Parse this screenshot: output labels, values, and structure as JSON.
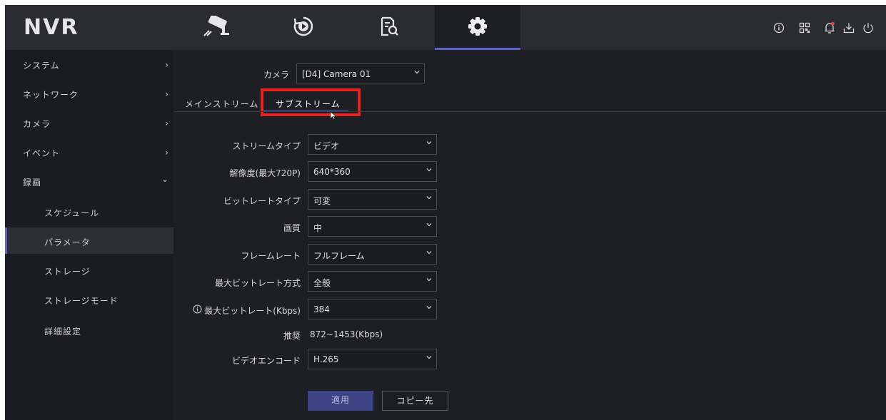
{
  "app": {
    "logo": "NVR"
  },
  "main_tabs": [
    {
      "icon": "camera-icon"
    },
    {
      "icon": "playback-icon"
    },
    {
      "icon": "search-file-icon"
    },
    {
      "icon": "gear-icon",
      "active": true
    }
  ],
  "top_icons": [
    "info-icon",
    "qr-code-icon",
    "bell-icon",
    "download-icon",
    "power-icon"
  ],
  "sidebar": {
    "items": [
      {
        "label": "システム",
        "arrow": "›"
      },
      {
        "label": "ネットワーク",
        "arrow": "›"
      },
      {
        "label": "カメラ",
        "arrow": "›"
      },
      {
        "label": "イベント",
        "arrow": "›"
      },
      {
        "label": "録画",
        "arrow": "⌄"
      },
      {
        "label": "スケジュール"
      },
      {
        "label": "パラメータ",
        "active": true
      },
      {
        "label": "ストレージ"
      },
      {
        "label": "ストレージモード"
      },
      {
        "label": "詳細設定"
      }
    ]
  },
  "camera": {
    "label": "カメラ",
    "value": "[D4] Camera 01"
  },
  "stream_tabs": {
    "main": "メインストリーム",
    "sub": "サブストリーム"
  },
  "form": {
    "stream_type": {
      "label": "ストリームタイプ",
      "value": "ビデオ"
    },
    "resolution": {
      "label": "解像度(最大720P)",
      "value": "640*360"
    },
    "bitrate_type": {
      "label": "ビットレートタイプ",
      "value": "可変"
    },
    "quality": {
      "label": "画質",
      "value": "中"
    },
    "frame_rate": {
      "label": "フレームレート",
      "value": "フルフレーム"
    },
    "max_bitrate_mode": {
      "label": "最大ビットレート方式",
      "value": "全般"
    },
    "max_bitrate": {
      "label": "最大ビットレート(Kbps)",
      "value": "384"
    },
    "recommended": {
      "label": "推奨",
      "value": "872~1453(Kbps)"
    },
    "video_encoding": {
      "label": "ビデオエンコード",
      "value": "H.265"
    }
  },
  "buttons": {
    "apply": "適用",
    "copy_to": "コピー先"
  },
  "colors": {
    "accent": "#5a63c8",
    "highlight_box": "#e8201e",
    "notification_dot": "#e0403a"
  }
}
